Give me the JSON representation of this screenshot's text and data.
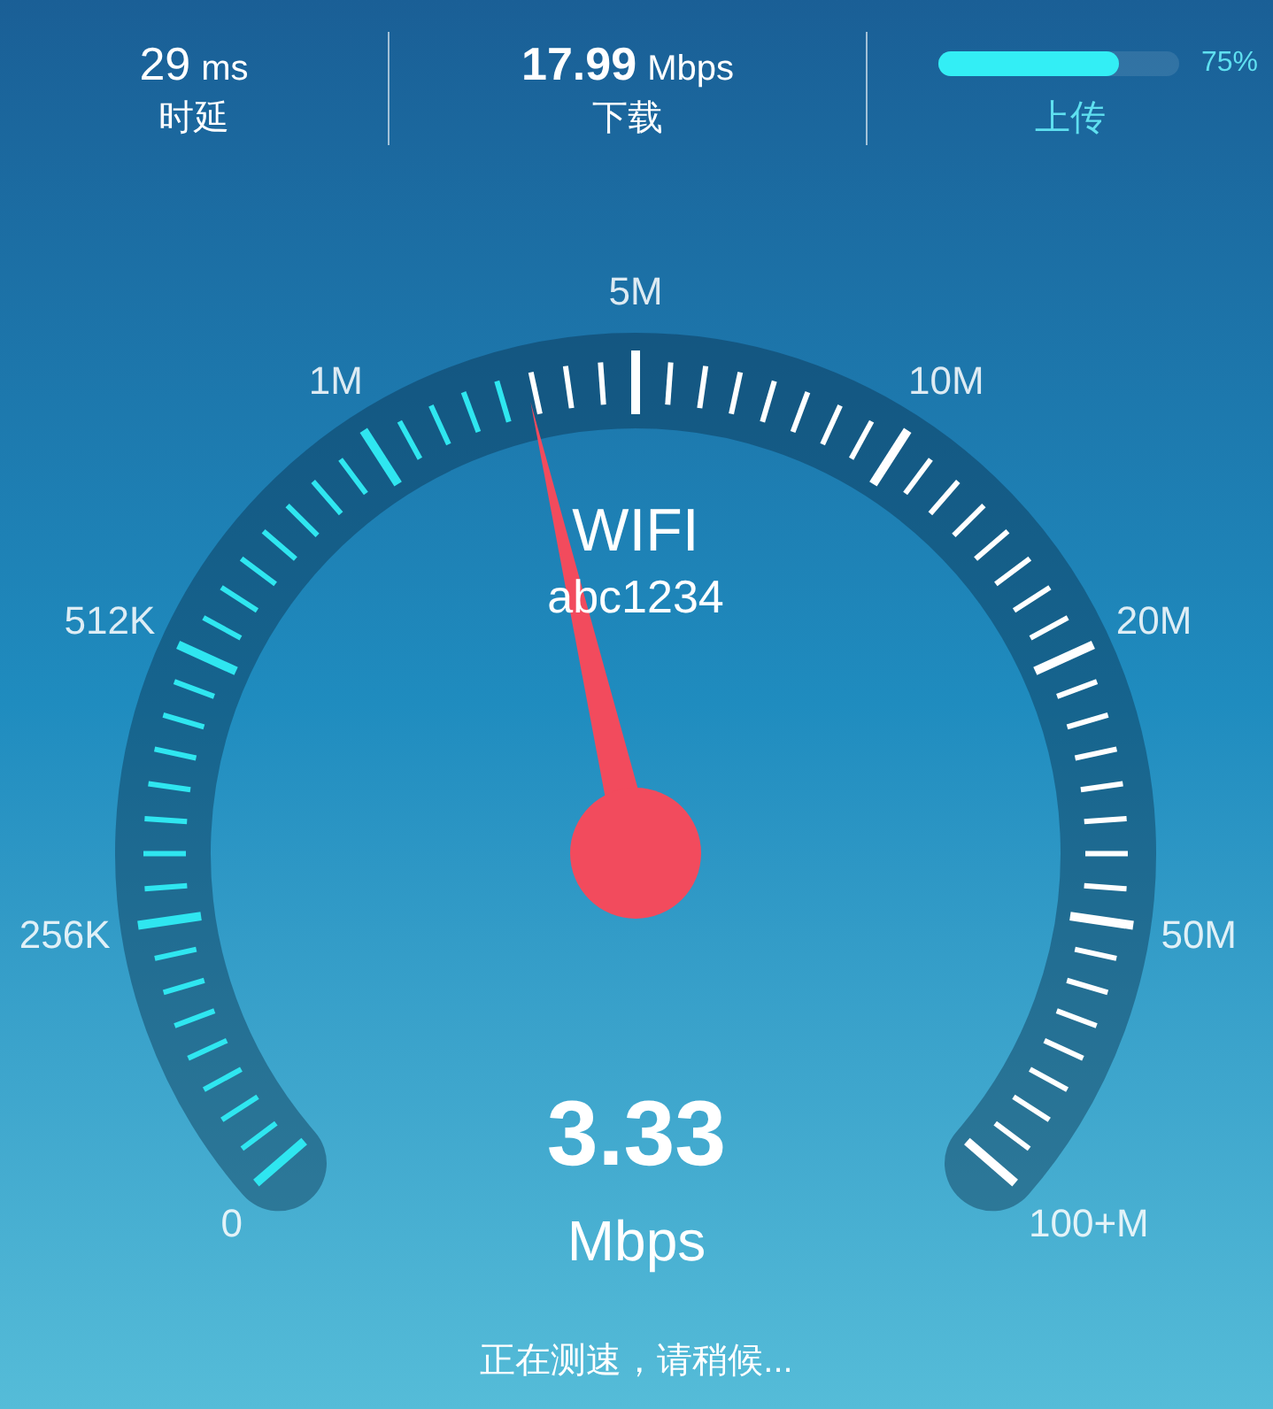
{
  "stats": [
    {
      "kind": "value",
      "value": "29",
      "unit": "ms",
      "label": "时延",
      "bold": false
    },
    {
      "kind": "value",
      "value": "17.99",
      "unit": "Mbps",
      "label": "下载",
      "bold": true
    },
    {
      "kind": "progress",
      "level": 0.75,
      "percent": "75%",
      "label": "上传"
    }
  ],
  "gauge": {
    "scale": [
      "0",
      "256K",
      "512K",
      "1M",
      "5M",
      "10M",
      "20M",
      "50M",
      "100+M"
    ],
    "network": "WIFI",
    "ssid": "abc1234"
  },
  "speed": {
    "value": "3.33",
    "unit": "Mbps"
  },
  "status": "正在测速，请稍候..."
}
